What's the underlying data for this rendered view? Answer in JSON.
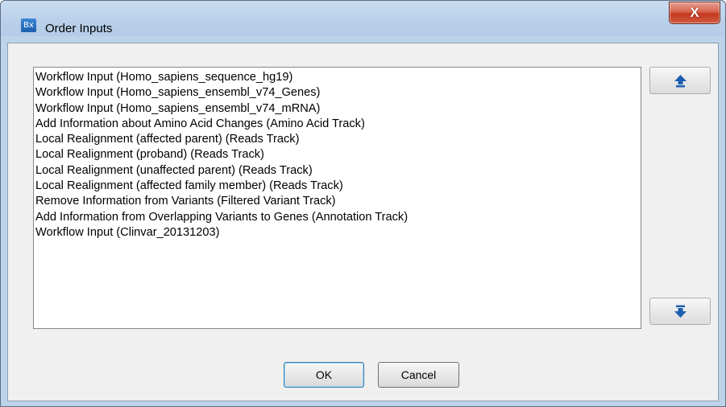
{
  "window": {
    "app_icon_text": "Bx",
    "title": "Order Inputs",
    "close_glyph": "X"
  },
  "inputs_list": {
    "items": [
      "Workflow Input (Homo_sapiens_sequence_hg19)",
      "Workflow Input (Homo_sapiens_ensembl_v74_Genes)",
      "Workflow Input (Homo_sapiens_ensembl_v74_mRNA)",
      "Add Information about Amino Acid Changes (Amino Acid Track)",
      "Local Realignment (affected parent) (Reads Track)",
      "Local Realignment (proband) (Reads Track)",
      "Local Realignment (unaffected parent) (Reads Track)",
      "Local Realignment (affected family member) (Reads Track)",
      "Remove Information from Variants (Filtered Variant Track)",
      "Add Information from Overlapping Variants to Genes (Annotation Track)",
      "Workflow Input (Clinvar_20131203)"
    ]
  },
  "buttons": {
    "ok": "OK",
    "cancel": "Cancel",
    "move_up_icon": "arrow-up-icon",
    "move_down_icon": "arrow-down-icon"
  },
  "colors": {
    "arrow": "#1c5fb0",
    "title_bar": "#b9d0ea",
    "close_button": "#c4381f"
  }
}
